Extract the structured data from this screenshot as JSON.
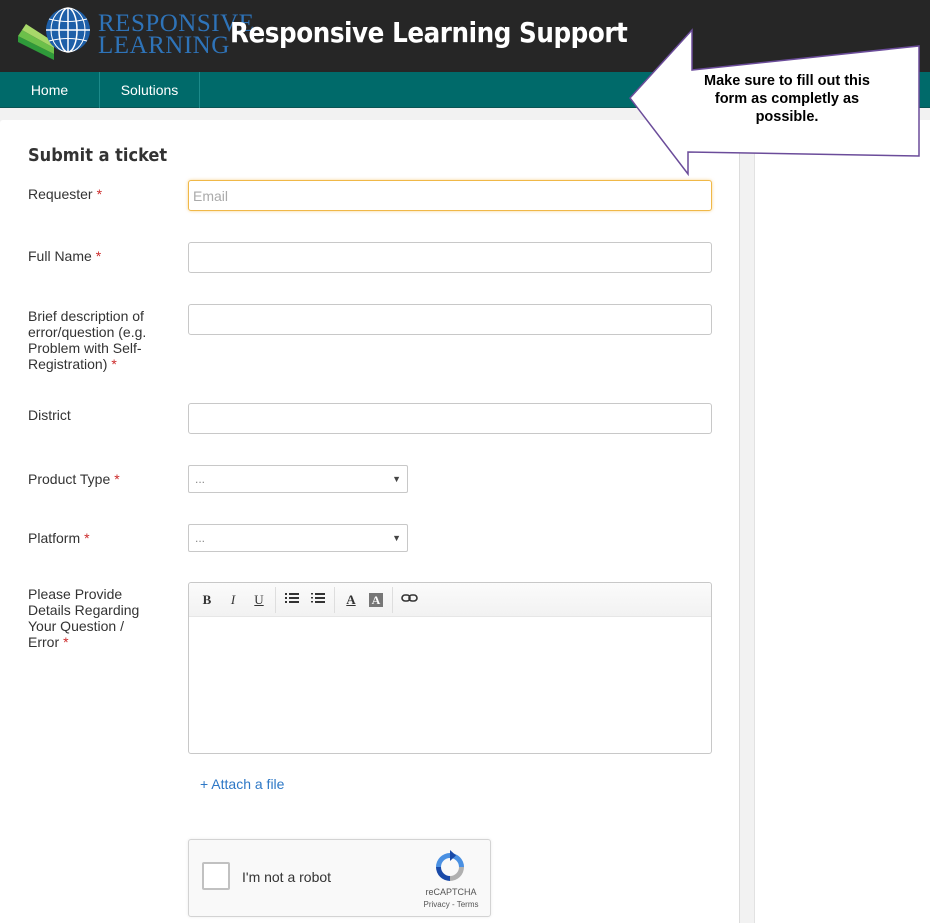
{
  "header": {
    "logo_line1": "RESPONSIVE",
    "logo_line2": "LEARNING",
    "title": "Responsive Learning Support"
  },
  "nav": {
    "items": [
      {
        "label": "Home"
      },
      {
        "label": "Solutions"
      }
    ]
  },
  "callout": {
    "text": "Make sure to fill out this form as completly as possible."
  },
  "form": {
    "title": "Submit a ticket",
    "requester": {
      "label": "Requester",
      "placeholder": "Email",
      "value": ""
    },
    "full_name": {
      "label": "Full Name",
      "value": ""
    },
    "description": {
      "label": "Brief description of error/question (e.g. Problem with Self-Registration)",
      "value": ""
    },
    "district": {
      "label": "District",
      "value": ""
    },
    "product_type": {
      "label": "Product Type",
      "selected": "..."
    },
    "platform": {
      "label": "Platform",
      "selected": "..."
    },
    "details": {
      "label": "Please Provide Details Regarding Your Question / Error"
    },
    "required_marker": "*",
    "toolbar": {
      "bold": "B",
      "italic": "I",
      "underline": "U",
      "text_color": "A",
      "bg_color": "A"
    },
    "attach_label": "+ Attach a file"
  },
  "captcha": {
    "label": "I'm not a robot",
    "brand": "reCAPTCHA",
    "links": "Privacy - Terms"
  },
  "icons": {
    "unordered_list": "unordered-list-icon",
    "ordered_list": "ordered-list-icon",
    "link": "link-icon",
    "recaptcha": "recaptcha-icon",
    "globe": "globe-icon"
  },
  "colors": {
    "header_bg": "#262626",
    "nav_bg": "#006a6a",
    "logo_blue": "#2e73b8",
    "required": "#cc2b2b",
    "link": "#2e78c6",
    "focus": "#f0b848"
  }
}
